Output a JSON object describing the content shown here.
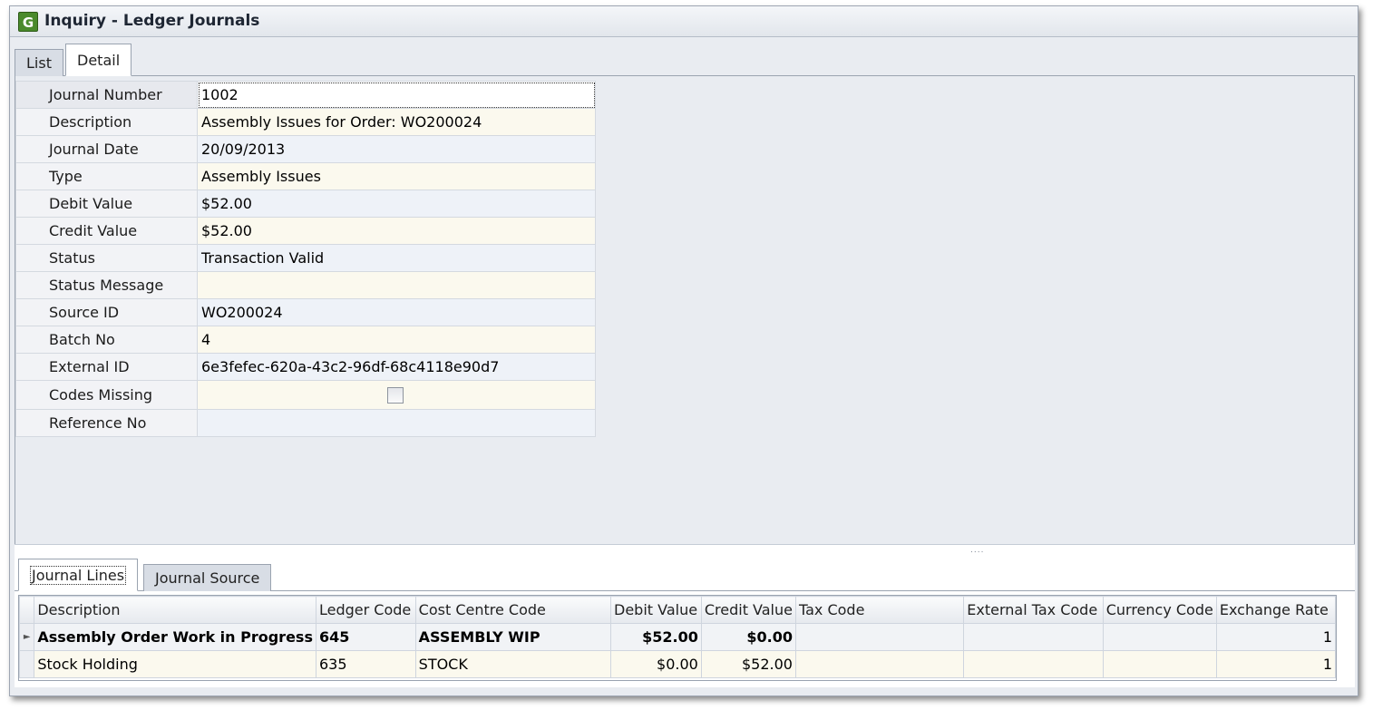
{
  "window": {
    "title": "Inquiry - Ledger Journals",
    "icon_letter": "G"
  },
  "top_tabs": [
    {
      "label": "List",
      "active": false
    },
    {
      "label": "Detail",
      "active": true
    }
  ],
  "fields": [
    {
      "label": "Journal Number",
      "value": "1002"
    },
    {
      "label": "Description",
      "value": "Assembly Issues for Order: WO200024"
    },
    {
      "label": "Journal Date",
      "value": "20/09/2013"
    },
    {
      "label": "Type",
      "value": "Assembly Issues"
    },
    {
      "label": "Debit Value",
      "value": "$52.00"
    },
    {
      "label": "Credit Value",
      "value": "$52.00"
    },
    {
      "label": "Status",
      "value": "Transaction Valid"
    },
    {
      "label": "Status Message",
      "value": ""
    },
    {
      "label": "Source ID",
      "value": "WO200024"
    },
    {
      "label": "Batch No",
      "value": "4"
    },
    {
      "label": "External ID",
      "value": "6e3fefec-620a-43c2-96df-68c4118e90d7"
    },
    {
      "label": "Codes Missing",
      "value": "",
      "checked": false
    },
    {
      "label": "Reference No",
      "value": ""
    }
  ],
  "splitter_grip": "....",
  "bottom_tabs": [
    {
      "label": "Journal Lines",
      "active": true
    },
    {
      "label": "Journal Source",
      "active": false
    }
  ],
  "lines_grid": {
    "columns": [
      "Description",
      "Ledger Code",
      "Cost Centre Code",
      "Debit Value",
      "Credit Value",
      "Tax Code",
      "External Tax Code",
      "Currency Code",
      "Exchange Rate"
    ],
    "rows": [
      [
        "Assembly Order Work in Progress",
        "645",
        "ASSEMBLY WIP",
        "$52.00",
        "$0.00",
        "",
        "",
        "",
        "1"
      ],
      [
        "Stock Holding",
        "635",
        "STOCK",
        "$0.00",
        "$52.00",
        "",
        "",
        "",
        "1"
      ]
    ],
    "row_indicator": "►"
  }
}
